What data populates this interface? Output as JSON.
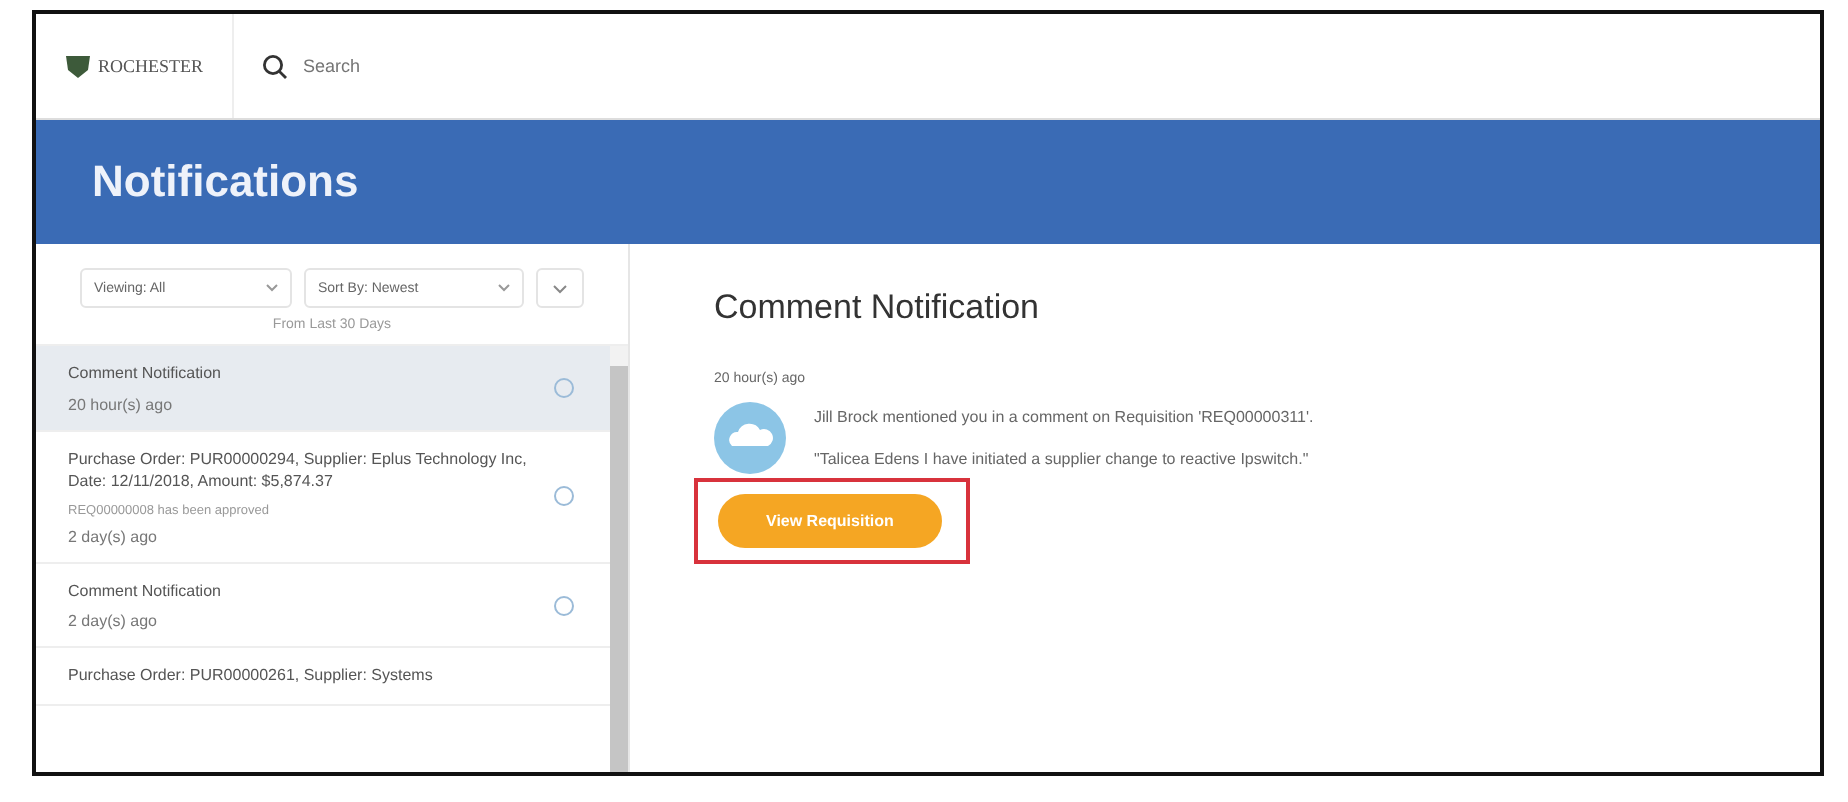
{
  "logo": {
    "text": "ROCHESTER"
  },
  "search": {
    "placeholder": "Search"
  },
  "header": {
    "title": "Notifications"
  },
  "filters": {
    "viewing": "Viewing: All",
    "sort": "Sort By: Newest",
    "range": "From Last 30 Days"
  },
  "notifications": [
    {
      "title": "Comment Notification",
      "time": "20 hour(s) ago",
      "selected": true
    },
    {
      "title": "Purchase Order: PUR00000294, Supplier: Eplus Technology Inc, Date: 12/11/2018, Amount: $5,874.37",
      "detail": "REQ00000008 has been approved",
      "time": "2 day(s) ago",
      "selected": false
    },
    {
      "title": "Comment Notification",
      "time": "2 day(s) ago",
      "selected": false
    },
    {
      "title": "Purchase Order: PUR00000261, Supplier: Systems",
      "selected": false
    }
  ],
  "detail": {
    "title": "Comment Notification",
    "time": "20 hour(s) ago",
    "message": "Jill Brock mentioned you in a comment on Requisition 'REQ00000311'.",
    "comment": "\"Talicea Edens I have initiated a supplier change to reactive Ipswitch.\"",
    "button": "View Requisition"
  }
}
